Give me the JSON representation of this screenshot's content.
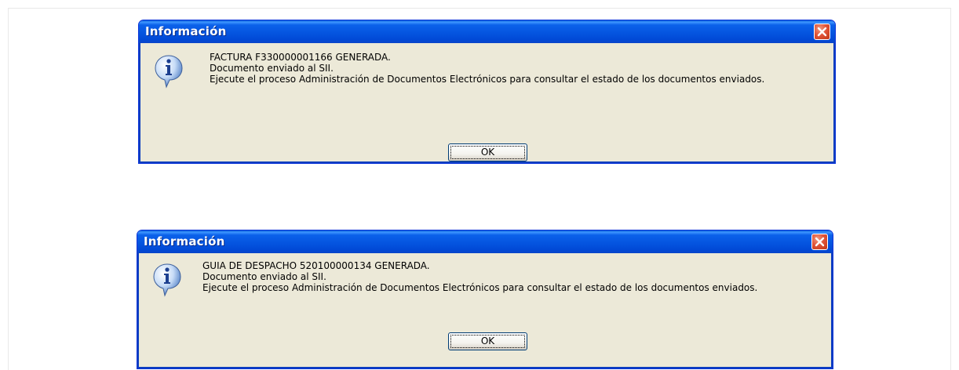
{
  "dialogs": [
    {
      "title": "Información",
      "lines": [
        "FACTURA F330000001166 GENERADA.",
        "Documento enviado al SII.",
        "Ejecute el proceso Administración de Documentos Electrónicos para consultar el estado de los documentos enviados."
      ],
      "ok_label": "OK",
      "icon": "information-icon",
      "close_icon": "close-icon"
    },
    {
      "title": "Información",
      "lines": [
        "GUIA DE DESPACHO  520100000134 GENERADA.",
        "Documento enviado al SII.",
        "Ejecute el proceso Administración de Documentos Electrónicos para consultar el estado de los documentos enviados."
      ],
      "ok_label": "OK",
      "icon": "information-icon",
      "close_icon": "close-icon"
    }
  ],
  "colors": {
    "titlebar": "#0555e0",
    "dialog_bg": "#ece9d8",
    "close_button": "#e0553a"
  }
}
